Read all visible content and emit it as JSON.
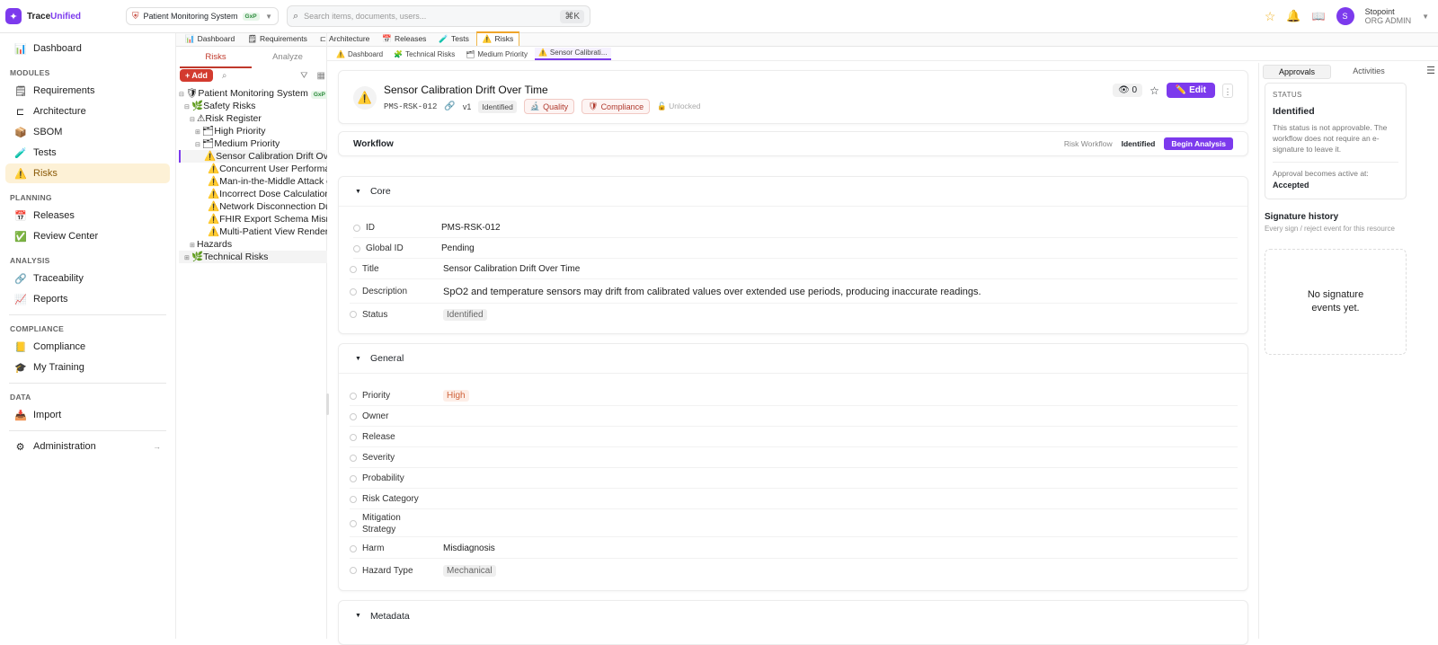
{
  "app": {
    "name_prefix": "Trace",
    "name_accent": "Unified"
  },
  "project": {
    "name": "Patient Monitoring System",
    "badge": "GxP"
  },
  "search": {
    "placeholder": "Search items, documents, users...",
    "shortcut": "⌘K"
  },
  "user": {
    "initial": "S",
    "name": "Stopoint",
    "role": "ORG ADMIN"
  },
  "nav": {
    "dashboard": "Dashboard",
    "modules_label": "MODULES",
    "requirements": "Requirements",
    "architecture": "Architecture",
    "sbom": "SBOM",
    "tests": "Tests",
    "risks": "Risks",
    "planning_label": "PLANNING",
    "releases": "Releases",
    "review_center": "Review Center",
    "analysis_label": "ANALYSIS",
    "traceability": "Traceability",
    "reports": "Reports",
    "compliance_label": "COMPLIANCE",
    "compliance": "Compliance",
    "my_training": "My Training",
    "data_label": "DATA",
    "import": "Import",
    "administration": "Administration"
  },
  "tabs": [
    "Dashboard",
    "Requirements",
    "Architecture",
    "Releases",
    "Tests",
    "Risks"
  ],
  "subtabs": [
    "Dashboard",
    "Technical Risks",
    "Medium Priority",
    "Sensor Calibrati..."
  ],
  "tree_panel": {
    "tab_risks": "Risks",
    "tab_analyze": "Analyze",
    "add_label": "+ Add",
    "nodes": [
      {
        "label": "Patient Monitoring System",
        "badge": "GxP"
      },
      {
        "label": "Safety Risks"
      },
      {
        "label": "Risk Register"
      },
      {
        "label": "High Priority"
      },
      {
        "label": "Medium Priority"
      },
      {
        "label": "Sensor Calibration Drift Over Time"
      },
      {
        "label": "Concurrent User Performance"
      },
      {
        "label": "Man-in-the-Middle Attack on"
      },
      {
        "label": "Incorrect Dose Calculation"
      },
      {
        "label": "Network Disconnection During"
      },
      {
        "label": "FHIR Export Schema Mismatch"
      },
      {
        "label": "Multi-Patient View Rendering"
      },
      {
        "label": "Hazards"
      },
      {
        "label": "Technical Risks"
      }
    ]
  },
  "item": {
    "title": "Sensor Calibration Drift Over Time",
    "key": "PMS-RSK-012",
    "version": "v1",
    "status": "Identified",
    "tag_quality": "Quality",
    "tag_compliance": "Compliance",
    "lock_state": "Unlocked",
    "watch_count": "0",
    "edit_label": "Edit"
  },
  "workflow": {
    "title": "Workflow",
    "name": "Risk Workflow",
    "current": "Identified",
    "action": "Begin Analysis"
  },
  "core": {
    "title": "Core",
    "fields": [
      {
        "label": "ID",
        "value": "PMS-RSK-012"
      },
      {
        "label": "Global ID",
        "value": "Pending"
      },
      {
        "label": "Title",
        "value": "Sensor Calibration Drift Over Time"
      },
      {
        "label": "Description",
        "value": "SpO2 and temperature sensors may drift from calibrated values over extended use periods, producing inaccurate readings."
      },
      {
        "label": "Status",
        "value": "Identified"
      }
    ]
  },
  "general": {
    "title": "General",
    "fields": [
      {
        "label": "Priority",
        "value": "High"
      },
      {
        "label": "Owner",
        "value": ""
      },
      {
        "label": "Release",
        "value": ""
      },
      {
        "label": "Severity",
        "value": ""
      },
      {
        "label": "Probability",
        "value": ""
      },
      {
        "label": "Risk Category",
        "value": ""
      },
      {
        "label": "Mitigation Strategy",
        "value": ""
      },
      {
        "label": "Harm",
        "value": "Misdiagnosis"
      },
      {
        "label": "Hazard Type",
        "value": "Mechanical"
      }
    ]
  },
  "metadata": {
    "title": "Metadata"
  },
  "right": {
    "tab_approvals": "Approvals",
    "tab_activities": "Activities",
    "status_label": "STATUS",
    "status_value": "Identified",
    "status_desc": "This status is not approvable. The workflow does not require an e-signature to leave it.",
    "approval_active_label": "Approval becomes active at:",
    "approval_active_value": "Accepted",
    "sig_title": "Signature history",
    "sig_sub": "Every sign / reject event for this resource",
    "sig_empty": "No signature events yet."
  },
  "colors": {
    "accent": "#7c3aed",
    "risk_active": "#fdf1d6",
    "danger": "#d33b2f"
  }
}
